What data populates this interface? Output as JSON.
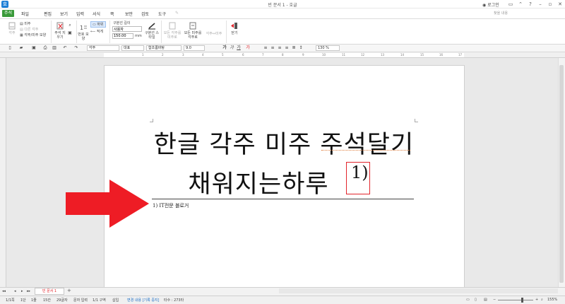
{
  "window": {
    "title": "빈 문서 1 - 호글",
    "app_icon": "호",
    "login_label": "로그인",
    "search_placeholder": "찾을 내용"
  },
  "menu": {
    "items": [
      "주석",
      "파일",
      "편집",
      "보기",
      "입력",
      "서식",
      "쪽",
      "보안",
      "검토",
      "도구"
    ]
  },
  "ribbon": {
    "footnote_label": "각주",
    "endnote_label": "미주",
    "other_note_label": "다른 각주",
    "to_endnote_label": "각주/미주 모양",
    "delete_note_label": "주석 지우기",
    "number_shape_label": "번호 모양",
    "dash_label": "하위",
    "line_label": "적게",
    "sep_line_label": "구분선 길이",
    "sep_line_value": "사용자",
    "sep_width_value": "150.00",
    "sep_unit": "mm",
    "sep_style_label": "구분선 스타일",
    "all_to_endnote_label": "모든 각주를 미주로",
    "all_to_footnote_label": "모든 미주를 각주로",
    "switch_label": "각주↔미주",
    "close_label": "닫기"
  },
  "toolbar": {
    "style": "각주",
    "font_lang": "대표",
    "font": "함초롬바탕",
    "size": "9.0",
    "unit": "pt",
    "zoom": "130",
    "zoom_unit": "%"
  },
  "ruler_ticks": [
    "1",
    "2",
    "3",
    "4",
    "5",
    "6",
    "7",
    "8",
    "9",
    "10",
    "11",
    "12",
    "13",
    "14",
    "15",
    "16",
    "17"
  ],
  "document": {
    "line1": "한글 각주 미주 주석달기",
    "line2": "채워지는하루",
    "footnote_mark": "1)",
    "footnote_text": "1) IT전문 블로거"
  },
  "sheet": {
    "tab_label": "빈 문서 1",
    "add_label": "+"
  },
  "status": {
    "page": "1/1쪽",
    "section": "1단",
    "line": "1줄",
    "col": "15칸",
    "chars": "29글자",
    "mode": "문자 입력",
    "area": "1/1 구역",
    "insert": "삽입",
    "track": "변경 내용 [기록 중지]",
    "typing": "타수 : 273타",
    "zoom_level": "155%"
  },
  "colors": {
    "accent": "#3a9a3a",
    "highlight": "#e2242b",
    "blue": "#1d7fd6"
  }
}
